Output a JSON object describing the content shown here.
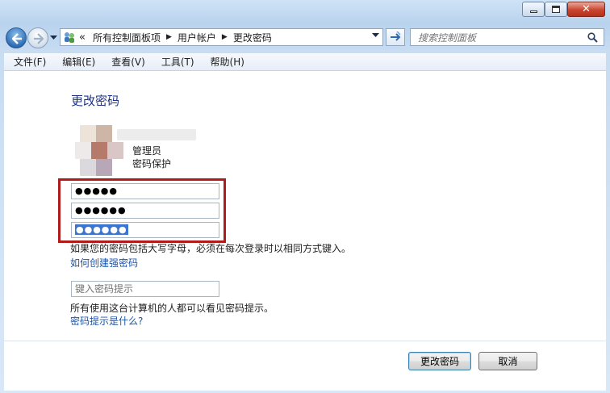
{
  "window": {
    "controls": [
      "minimize-icon",
      "maximize-icon",
      "close-icon"
    ],
    "accent": "#b9d3ee",
    "close_color": "#c8452f"
  },
  "address": {
    "overflow": "«",
    "crumbs": [
      "所有控制面板项",
      "用户帐户",
      "更改密码"
    ]
  },
  "search": {
    "placeholder": "搜索控制面板"
  },
  "menu": [
    "文件(F)",
    "编辑(E)",
    "查看(V)",
    "工具(T)",
    "帮助(H)"
  ],
  "page": {
    "title": "更改密码",
    "role": "管理员",
    "protection": "密码保护",
    "current_password": "●●●●●",
    "new_password": "●●●●●●",
    "confirm_password": "●●●●●●",
    "hint_text": "如果您的密码包括大写字母，必须在每次登录时以相同方式键入。",
    "link_strong": "如何创建强密码",
    "hint_placeholder": "键入密码提示",
    "hint_note": "所有使用这台计算机的人都可以看见密码提示。",
    "link_hint": "密码提示是什么?",
    "highlight_color": "#b01b1b"
  },
  "buttons": {
    "change": "更改密码",
    "cancel": "取消"
  }
}
